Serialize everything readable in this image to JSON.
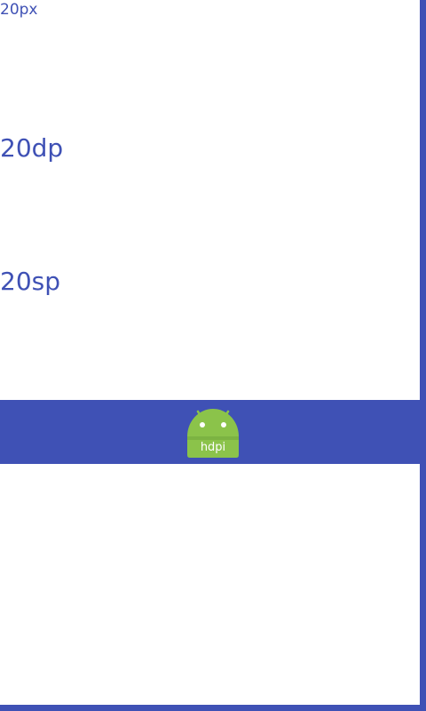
{
  "labels": {
    "px": "20px",
    "dp": "20dp",
    "sp": "20sp"
  },
  "icon": {
    "name": "android-launcher-icon",
    "text": "hdpi"
  },
  "colors": {
    "primary": "#3f51b5",
    "android_green": "#8bc34a",
    "android_green_dark": "#689f38",
    "background": "#ffffff"
  }
}
